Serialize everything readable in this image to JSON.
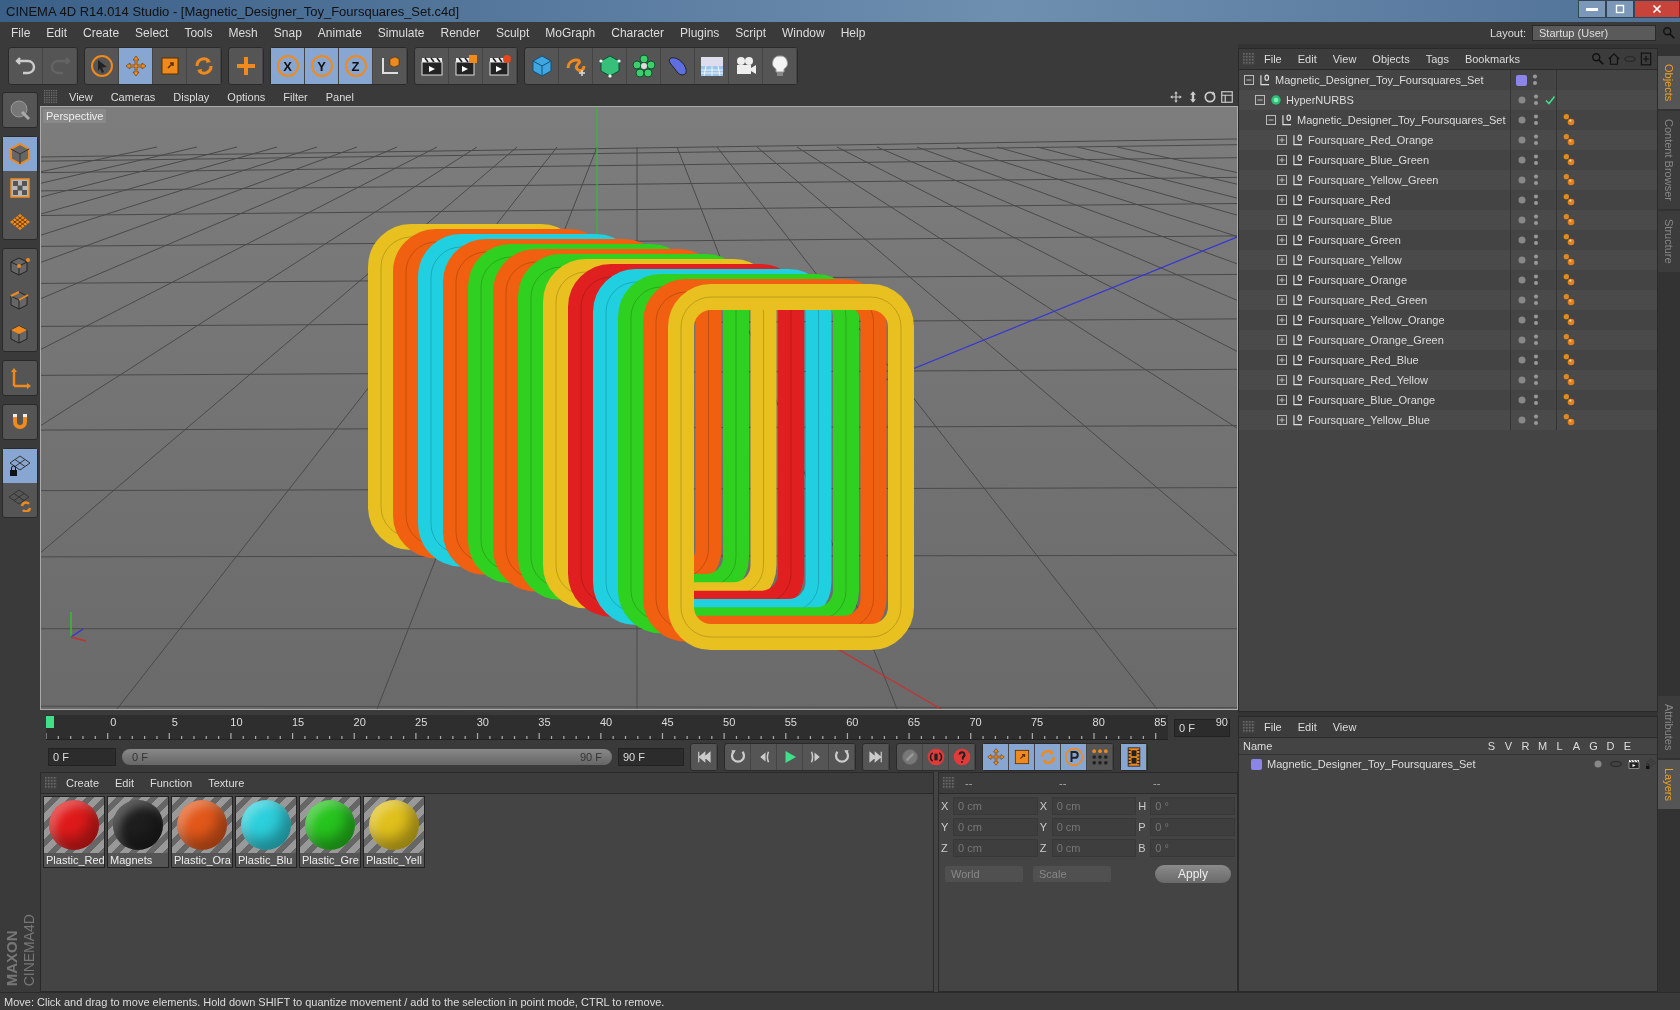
{
  "window": {
    "title": "CINEMA 4D R14.014 Studio - [Magnetic_Designer_Toy_Foursquares_Set.c4d]"
  },
  "menu_bar": [
    "File",
    "Edit",
    "Create",
    "Select",
    "Tools",
    "Mesh",
    "Snap",
    "Animate",
    "Simulate",
    "Render",
    "Sculpt",
    "MoGraph",
    "Character",
    "Plugins",
    "Script",
    "Window",
    "Help"
  ],
  "layout": {
    "label": "Layout:",
    "value": "Startup (User)"
  },
  "toolbar": [
    [
      {
        "kind": "undo",
        "selected": false,
        "disabled": false
      },
      {
        "kind": "redo",
        "selected": false,
        "disabled": true
      }
    ],
    [
      {
        "kind": "cursor",
        "selected": false,
        "disabled": false
      },
      {
        "kind": "move",
        "selected": true,
        "disabled": false
      },
      {
        "kind": "scale",
        "selected": false,
        "disabled": false
      },
      {
        "kind": "rotate",
        "selected": false,
        "disabled": false
      }
    ],
    [
      {
        "kind": "plus",
        "selected": false,
        "disabled": false
      }
    ],
    [
      {
        "kind": "axis",
        "label": "X",
        "selected": true,
        "disabled": false
      },
      {
        "kind": "axis",
        "label": "Y",
        "selected": true,
        "disabled": false
      },
      {
        "kind": "axis",
        "label": "Z",
        "selected": true,
        "disabled": false
      },
      {
        "kind": "coordinate-system",
        "selected": false,
        "disabled": false
      }
    ],
    [
      {
        "kind": "clapper",
        "selected": false,
        "disabled": false
      },
      {
        "kind": "clapper-render",
        "selected": false,
        "disabled": false
      },
      {
        "kind": "clapper-gear",
        "selected": false,
        "disabled": false
      }
    ],
    [
      {
        "kind": "cube",
        "selected": false,
        "disabled": false
      },
      {
        "kind": "spline",
        "selected": false,
        "disabled": false
      },
      {
        "kind": "nurbs-cube",
        "selected": false,
        "disabled": false
      },
      {
        "kind": "flower",
        "selected": false,
        "disabled": false
      },
      {
        "kind": "deformer",
        "selected": false,
        "disabled": false
      },
      {
        "kind": "floor",
        "selected": false,
        "disabled": false
      },
      {
        "kind": "camera",
        "selected": false,
        "disabled": false
      },
      {
        "kind": "light-bulb",
        "selected": false,
        "disabled": false
      }
    ]
  ],
  "left_tools": [
    [
      {
        "kind": "sculpt-sphere",
        "selected": false
      }
    ],
    [
      {
        "kind": "model-cube",
        "selected": true
      },
      {
        "kind": "checker",
        "selected": false
      },
      {
        "kind": "workplane",
        "selected": false
      }
    ],
    [
      {
        "kind": "points-cube",
        "selected": false
      },
      {
        "kind": "edges-cube",
        "selected": false
      },
      {
        "kind": "polygons-cube",
        "selected": false
      }
    ],
    [
      {
        "kind": "axis-arrows",
        "selected": false
      }
    ],
    [
      {
        "kind": "magnet",
        "selected": false
      }
    ],
    [
      {
        "kind": "lock-grid",
        "selected": true
      },
      {
        "kind": "sync-grid",
        "selected": false
      }
    ]
  ],
  "viewport": {
    "menu": [
      "View",
      "Cameras",
      "Display",
      "Options",
      "Filter",
      "Panel"
    ],
    "camera_label": "Perspective"
  },
  "timeline": {
    "ticks": [
      "0",
      "5",
      "10",
      "15",
      "20",
      "25",
      "30",
      "35",
      "40",
      "45",
      "50",
      "55",
      "60",
      "65",
      "70",
      "75",
      "80",
      "85",
      "90"
    ],
    "current_frame": "0 F"
  },
  "playback": {
    "start": "0 F",
    "range_start": "0 F",
    "range_end": "90 F",
    "end": "90 F",
    "key_modes": [
      {
        "kind": "move",
        "selected": true
      },
      {
        "kind": "scale",
        "selected": true
      },
      {
        "kind": "rotate",
        "selected": true
      },
      {
        "kind": "param",
        "selected": true
      },
      {
        "kind": "dots",
        "selected": false
      }
    ],
    "timeline_view_selected": true
  },
  "materials": {
    "menu": [
      "Create",
      "Edit",
      "Function",
      "Texture"
    ],
    "items": [
      {
        "name": "Plastic_Red",
        "color": "#e01a1a"
      },
      {
        "name": "Magnets",
        "color": "#1e1e1e"
      },
      {
        "name": "Plastic_Ora",
        "color": "#e2581a"
      },
      {
        "name": "Plastic_Blu",
        "color": "#2ccfdc"
      },
      {
        "name": "Plastic_Gre",
        "color": "#26c41e"
      },
      {
        "name": "Plastic_Yell",
        "color": "#e0c01c"
      }
    ]
  },
  "coordinates": {
    "headers": [
      "--",
      "--",
      "--"
    ],
    "rows": [
      [
        {
          "axis": "X",
          "value": "0 cm"
        },
        {
          "axis": "X",
          "value": "0 cm"
        },
        {
          "axis": "H",
          "value": "0 °"
        }
      ],
      [
        {
          "axis": "Y",
          "value": "0 cm"
        },
        {
          "axis": "Y",
          "value": "0 cm"
        },
        {
          "axis": "P",
          "value": "0 °"
        }
      ],
      [
        {
          "axis": "Z",
          "value": "0 cm"
        },
        {
          "axis": "Z",
          "value": "0 cm"
        },
        {
          "axis": "B",
          "value": "0 °"
        }
      ]
    ],
    "space": "World",
    "mode": "Scale",
    "apply": "Apply"
  },
  "objects": {
    "menu": [
      "File",
      "Edit",
      "View",
      "Objects",
      "Tags",
      "Bookmarks"
    ],
    "tree": [
      {
        "name": "Magnetic_Designer_Toy_Foursquares_Set",
        "kind": "null",
        "expanded": true,
        "color": "#8b85e8",
        "material_tag": false,
        "children": [
          {
            "name": "HyperNURBS",
            "kind": "nurbs",
            "expanded": true,
            "enabled": true,
            "material_tag": false,
            "children": [
              {
                "name": "Magnetic_Designer_Toy_Foursquares_Set",
                "kind": "null",
                "expanded": true,
                "material_tag": true,
                "children": [
                  {
                    "name": "Foursquare_Red_Orange",
                    "kind": "null",
                    "expanded": false,
                    "material_tag": true
                  },
                  {
                    "name": "Foursquare_Blue_Green",
                    "kind": "null",
                    "expanded": false,
                    "material_tag": true
                  },
                  {
                    "name": "Foursquare_Yellow_Green",
                    "kind": "null",
                    "expanded": false,
                    "material_tag": true
                  },
                  {
                    "name": "Foursquare_Red",
                    "kind": "null",
                    "expanded": false,
                    "material_tag": true
                  },
                  {
                    "name": "Foursquare_Blue",
                    "kind": "null",
                    "expanded": false,
                    "material_tag": true
                  },
                  {
                    "name": "Foursquare_Green",
                    "kind": "null",
                    "expanded": false,
                    "material_tag": true
                  },
                  {
                    "name": "Foursquare_Yellow",
                    "kind": "null",
                    "expanded": false,
                    "material_tag": true
                  },
                  {
                    "name": "Foursquare_Orange",
                    "kind": "null",
                    "expanded": false,
                    "material_tag": true
                  },
                  {
                    "name": "Foursquare_Red_Green",
                    "kind": "null",
                    "expanded": false,
                    "material_tag": true
                  },
                  {
                    "name": "Foursquare_Yellow_Orange",
                    "kind": "null",
                    "expanded": false,
                    "material_tag": true
                  },
                  {
                    "name": "Foursquare_Orange_Green",
                    "kind": "null",
                    "expanded": false,
                    "material_tag": true
                  },
                  {
                    "name": "Foursquare_Red_Blue",
                    "kind": "null",
                    "expanded": false,
                    "material_tag": true
                  },
                  {
                    "name": "Foursquare_Red_Yellow",
                    "kind": "null",
                    "expanded": false,
                    "material_tag": true
                  },
                  {
                    "name": "Foursquare_Blue_Orange",
                    "kind": "null",
                    "expanded": false,
                    "material_tag": true
                  },
                  {
                    "name": "Foursquare_Yellow_Blue",
                    "kind": "null",
                    "expanded": false,
                    "material_tag": true
                  }
                ]
              }
            ]
          }
        ]
      }
    ]
  },
  "side_tabs_top": [
    {
      "label": "Objects",
      "selected": true
    },
    {
      "label": "Content Browser",
      "selected": false
    },
    {
      "label": "Structure",
      "selected": false
    }
  ],
  "side_tabs_bottom": [
    {
      "label": "Attributes",
      "selected": false
    },
    {
      "label": "Layers",
      "selected": true
    }
  ],
  "layers": {
    "menu": [
      "File",
      "Edit",
      "View"
    ],
    "columns": [
      "Name",
      "S",
      "V",
      "R",
      "M",
      "L",
      "A",
      "G",
      "D",
      "E"
    ],
    "rows": [
      {
        "name": "Magnetic_Designer_Toy_Foursquares_Set",
        "color": "#8b85e8"
      }
    ]
  },
  "brand": [
    "MAXON",
    "CINEMA4D"
  ],
  "status_bar": "Move: Click and drag to move elements. Hold down SHIFT to quantize movement / add to the selection in point mode, CTRL to remove."
}
